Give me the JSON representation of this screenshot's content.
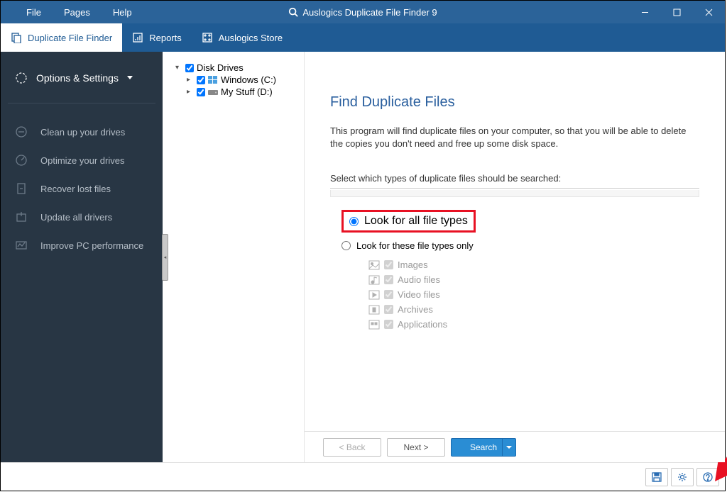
{
  "menus": {
    "file": "File",
    "pages": "Pages",
    "help": "Help"
  },
  "title": "Auslogics Duplicate File Finder 9",
  "tabs": {
    "dff": "Duplicate File Finder",
    "reports": "Reports",
    "store": "Auslogics Store"
  },
  "sidebar": {
    "header": "Options & Settings",
    "items": [
      "Clean up your drives",
      "Optimize your drives",
      "Recover lost files",
      "Update all drivers",
      "Improve PC performance"
    ]
  },
  "tree": {
    "root": "Disk Drives",
    "drives": [
      {
        "label": "Windows (C:)"
      },
      {
        "label": "My Stuff (D:)"
      }
    ]
  },
  "main": {
    "heading": "Find Duplicate Files",
    "description": "This program will find duplicate files on your computer, so that you will be able to delete the copies you don't need and free up some disk space.",
    "section_label": "Select which types of duplicate files should be searched:",
    "radio_all": "Look for all file types",
    "radio_only": "Look for these file types only",
    "file_types": [
      "Images",
      "Audio files",
      "Video files",
      "Archives",
      "Applications"
    ]
  },
  "nav": {
    "back": "< Back",
    "next": "Next >",
    "search": "Search"
  }
}
